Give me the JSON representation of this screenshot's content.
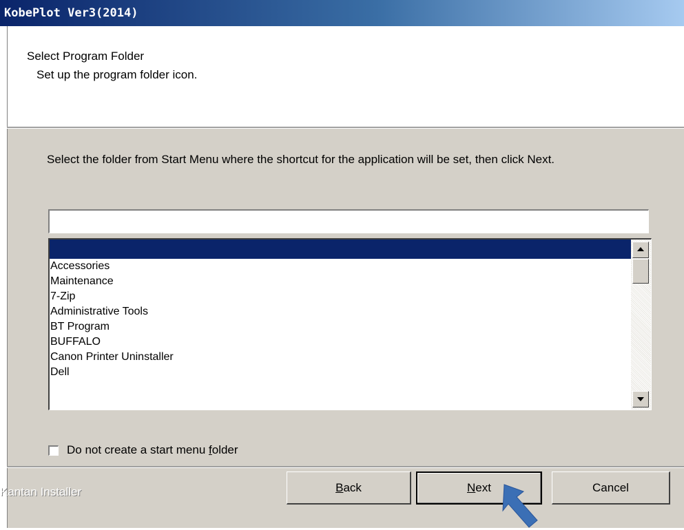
{
  "window": {
    "title": "KobePlot Ver3(2014)"
  },
  "header": {
    "title": "Select Program Folder",
    "subtitle": "Set up the program folder icon."
  },
  "content": {
    "instruction": "Select the folder from Start Menu where the shortcut for the application will be set, then click Next.",
    "folder_input_value": "",
    "list_items": [
      "",
      "Accessories",
      "Maintenance",
      "7-Zip",
      "Administrative Tools",
      "BT Program",
      "BUFFALO",
      "Canon Printer Uninstaller",
      "Dell"
    ],
    "selected_index": 0,
    "checkbox_label_pre": "Do not create a start menu ",
    "checkbox_label_accel": "f",
    "checkbox_label_post": "older",
    "checkbox_checked": false
  },
  "footer": {
    "brand": "Kantan Installer",
    "back_accel": "B",
    "back_rest": "ack",
    "next_accel": "N",
    "next_rest": "ext",
    "cancel_label": "Cancel"
  },
  "colors": {
    "selection": "#0a246a",
    "dialog_bg": "#d4d0c8",
    "pointer_arrow": "#3b6fb5"
  },
  "icons": [
    "scroll-up-arrow-icon",
    "scroll-down-arrow-icon",
    "pointer-arrow-icon"
  ]
}
